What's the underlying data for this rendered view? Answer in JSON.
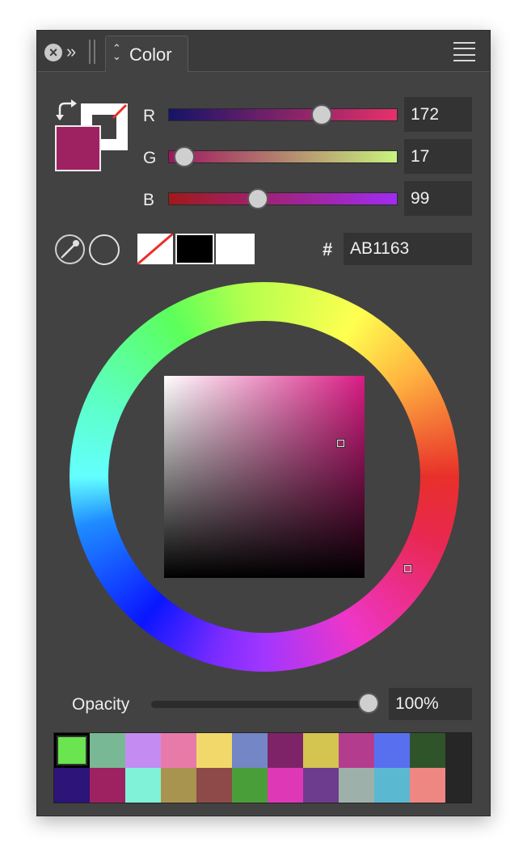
{
  "panel": {
    "tab_label": "Color",
    "close_icon": "close-icon",
    "collapse_glyph": "»",
    "menu_icon": "hamburger-menu-icon"
  },
  "swatches": {
    "fill_color": "#9e2261",
    "stroke_color": "#ffffff"
  },
  "channels": {
    "r": {
      "label": "R",
      "value": "172",
      "gradient_from": "#141468",
      "gradient_to": "#e8306a",
      "fraction": 0.67
    },
    "g": {
      "label": "G",
      "value": "17",
      "gradient_from": "#9e1560",
      "gradient_to": "#c8f47e",
      "fraction": 0.07
    },
    "b": {
      "label": "B",
      "value": "99",
      "gradient_from": "#a01a1a",
      "gradient_to": "#a02cf2",
      "fraction": 0.39
    }
  },
  "hex": {
    "label": "#",
    "value": "AB1163"
  },
  "quick_colors": [
    "none",
    "#000000",
    "#ffffff"
  ],
  "opacity": {
    "label": "Opacity",
    "value": "100%",
    "fraction": 1.0
  },
  "palette": {
    "row1": [
      "#6ae44f",
      "#79b895",
      "#c48cf2",
      "#e87aaa",
      "#f2d86a",
      "#7486c6",
      "#7e2368",
      "#d4c450",
      "#b43c8e",
      "#5870f0",
      "#30542a"
    ],
    "row2": [
      "#2c1478",
      "#9e2261",
      "#7ff2d8",
      "#a8944e",
      "#8e4a48",
      "#4a9e3a",
      "#de38b6",
      "#6e3c8e",
      "#9eb0aa",
      "#5ab8d0",
      "#ee8682"
    ],
    "selected_index": 0
  }
}
